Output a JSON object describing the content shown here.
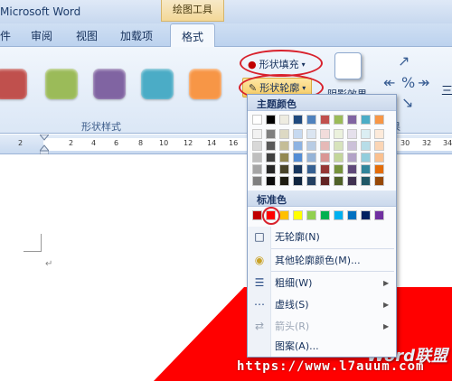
{
  "window": {
    "app_title": "Microsoft Word",
    "context_tab_group": "绘图工具"
  },
  "tabs": [
    {
      "label": "件"
    },
    {
      "label": "审阅"
    },
    {
      "label": "视图"
    },
    {
      "label": "加载项"
    },
    {
      "label": "格式",
      "active": true
    }
  ],
  "ribbon": {
    "style_swatches": [
      "#c0504d",
      "#9bbb59",
      "#8064a2",
      "#4bacc6",
      "#f79646"
    ],
    "shape_styles_label": "形状样式",
    "shape_fill_label": "形状填充",
    "shape_outline_label": "形状轮廓",
    "shadow_effect_label": "阴影效果",
    "group_fragment": "果",
    "right_fragment": "三"
  },
  "ruler": {
    "numbers": [
      "2",
      "2",
      "4",
      "6",
      "8",
      "10",
      "12",
      "14",
      "16",
      "30",
      "32",
      "34"
    ]
  },
  "dropdown": {
    "theme_colors_header": "主题颜色",
    "standard_colors_header": "标准色",
    "theme_top": [
      "#ffffff",
      "#000000",
      "#eeece1",
      "#1f497d",
      "#4f81bd",
      "#c0504d",
      "#9bbb59",
      "#8064a2",
      "#4bacc6",
      "#f79646"
    ],
    "theme_shades": [
      [
        "#f2f2f2",
        "#7f7f7f",
        "#ddd9c3",
        "#c6d9f0",
        "#dbe5f1",
        "#f2dcdb",
        "#ebf1dd",
        "#e5e0ec",
        "#dbeef3",
        "#fdeada"
      ],
      [
        "#d8d8d8",
        "#595959",
        "#c4bd97",
        "#8db3e2",
        "#b8cce4",
        "#e5b9b7",
        "#d7e3bc",
        "#ccc1d9",
        "#b7dde8",
        "#fbd5b5"
      ],
      [
        "#bfbfbf",
        "#3f3f3f",
        "#938953",
        "#548dd4",
        "#95b3d7",
        "#d99694",
        "#c3d69b",
        "#b2a2c7",
        "#92cddc",
        "#fac08f"
      ],
      [
        "#a5a5a5",
        "#262626",
        "#494429",
        "#17365d",
        "#366092",
        "#953734",
        "#76923c",
        "#5f497a",
        "#31859b",
        "#e36c09"
      ],
      [
        "#7f7f7f",
        "#0c0c0c",
        "#1d1b10",
        "#0f243e",
        "#244061",
        "#632423",
        "#4f6128",
        "#3f3151",
        "#205867",
        "#974806"
      ]
    ],
    "standard": [
      "#c00000",
      "#ff0000",
      "#ffc000",
      "#ffff00",
      "#92d050",
      "#00b050",
      "#00b0f0",
      "#0070c0",
      "#002060",
      "#7030a0"
    ],
    "no_outline_label": "无轮廓(N)",
    "more_colors_label": "其他轮廓颜色(M)...",
    "weight_label": "粗细(W)",
    "dashes_label": "虚线(S)",
    "arrows_label": "箭头(R)",
    "pattern_label": "图案(A)..."
  },
  "watermark": {
    "url": "https://www.l7auum.com",
    "logo": "Word联盟"
  },
  "accent_red": "#ff0000"
}
